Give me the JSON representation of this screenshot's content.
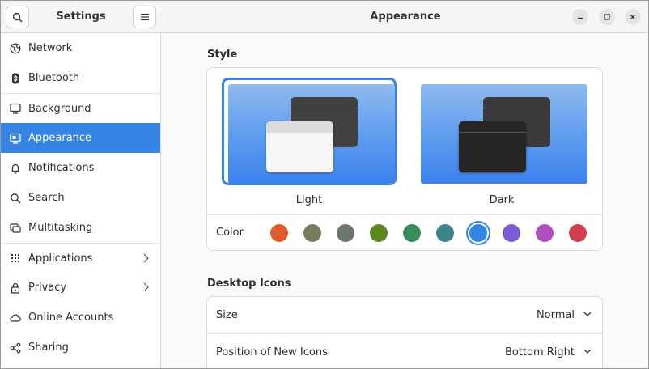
{
  "sidebar": {
    "title": "Settings",
    "items": [
      {
        "label": "Network",
        "icon": "globe-icon"
      },
      {
        "label": "Bluetooth",
        "icon": "bluetooth-icon"
      },
      {
        "label": "Background",
        "icon": "background-icon"
      },
      {
        "label": "Appearance",
        "icon": "appearance-icon"
      },
      {
        "label": "Notifications",
        "icon": "bell-icon"
      },
      {
        "label": "Search",
        "icon": "search-icon"
      },
      {
        "label": "Multitasking",
        "icon": "multitasking-icon"
      },
      {
        "label": "Applications",
        "icon": "grid-icon"
      },
      {
        "label": "Privacy",
        "icon": "lock-icon"
      },
      {
        "label": "Online Accounts",
        "icon": "cloud-icon"
      },
      {
        "label": "Sharing",
        "icon": "share-icon"
      }
    ]
  },
  "header": {
    "title": "Appearance"
  },
  "style": {
    "title": "Style",
    "options": [
      {
        "label": "Light",
        "selected": true
      },
      {
        "label": "Dark",
        "selected": false
      }
    ],
    "color_label": "Color",
    "colors": [
      "#dd5b2c",
      "#7a7a5c",
      "#6c786d",
      "#5a8a1d",
      "#3b8a5a",
      "#3f8289",
      "#3584e4",
      "#7c5cd6",
      "#b14fbf",
      "#d23e4f"
    ],
    "selected_color": "#3584e4"
  },
  "desktop_icons": {
    "title": "Desktop Icons",
    "rows": [
      {
        "label": "Size",
        "value": "Normal"
      },
      {
        "label": "Position of New Icons",
        "value": "Bottom Right"
      }
    ]
  }
}
